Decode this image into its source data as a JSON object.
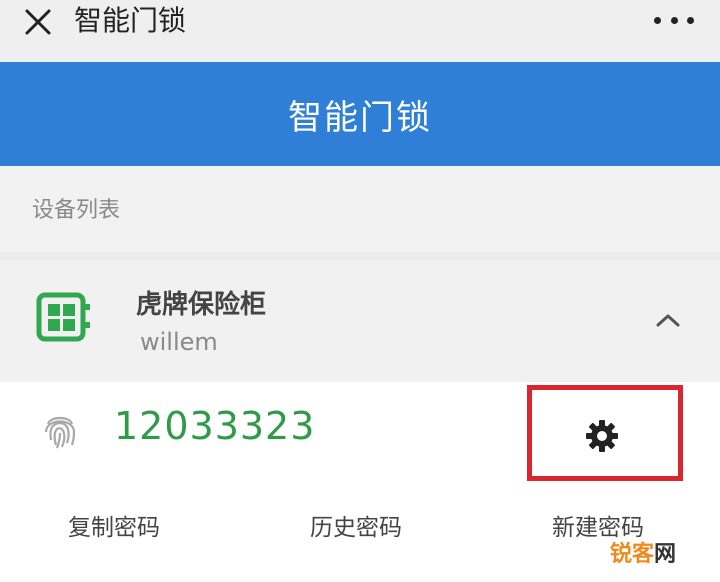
{
  "topbar": {
    "title": "智能门锁",
    "close_icon": "close-icon",
    "more_icon": "more-icon"
  },
  "banner": {
    "title": "智能门锁",
    "color": "#2f7fd6"
  },
  "section": {
    "label": "设备列表"
  },
  "device": {
    "name": "虎牌保险柜",
    "user": "willem",
    "icon": "safe-device-icon",
    "icon_color": "#2fa84f",
    "expanded_icon": "chevron-up-icon"
  },
  "detail": {
    "password": "12033323",
    "password_color": "#2f9b46",
    "fingerprint_icon": "fingerprint-icon",
    "settings_icon": "gear-icon",
    "highlight_color": "#d9262f",
    "actions": [
      "复制密码",
      "历史密码",
      "新建密码"
    ]
  },
  "watermark": {
    "part1": "锐客",
    "part2": "网"
  }
}
